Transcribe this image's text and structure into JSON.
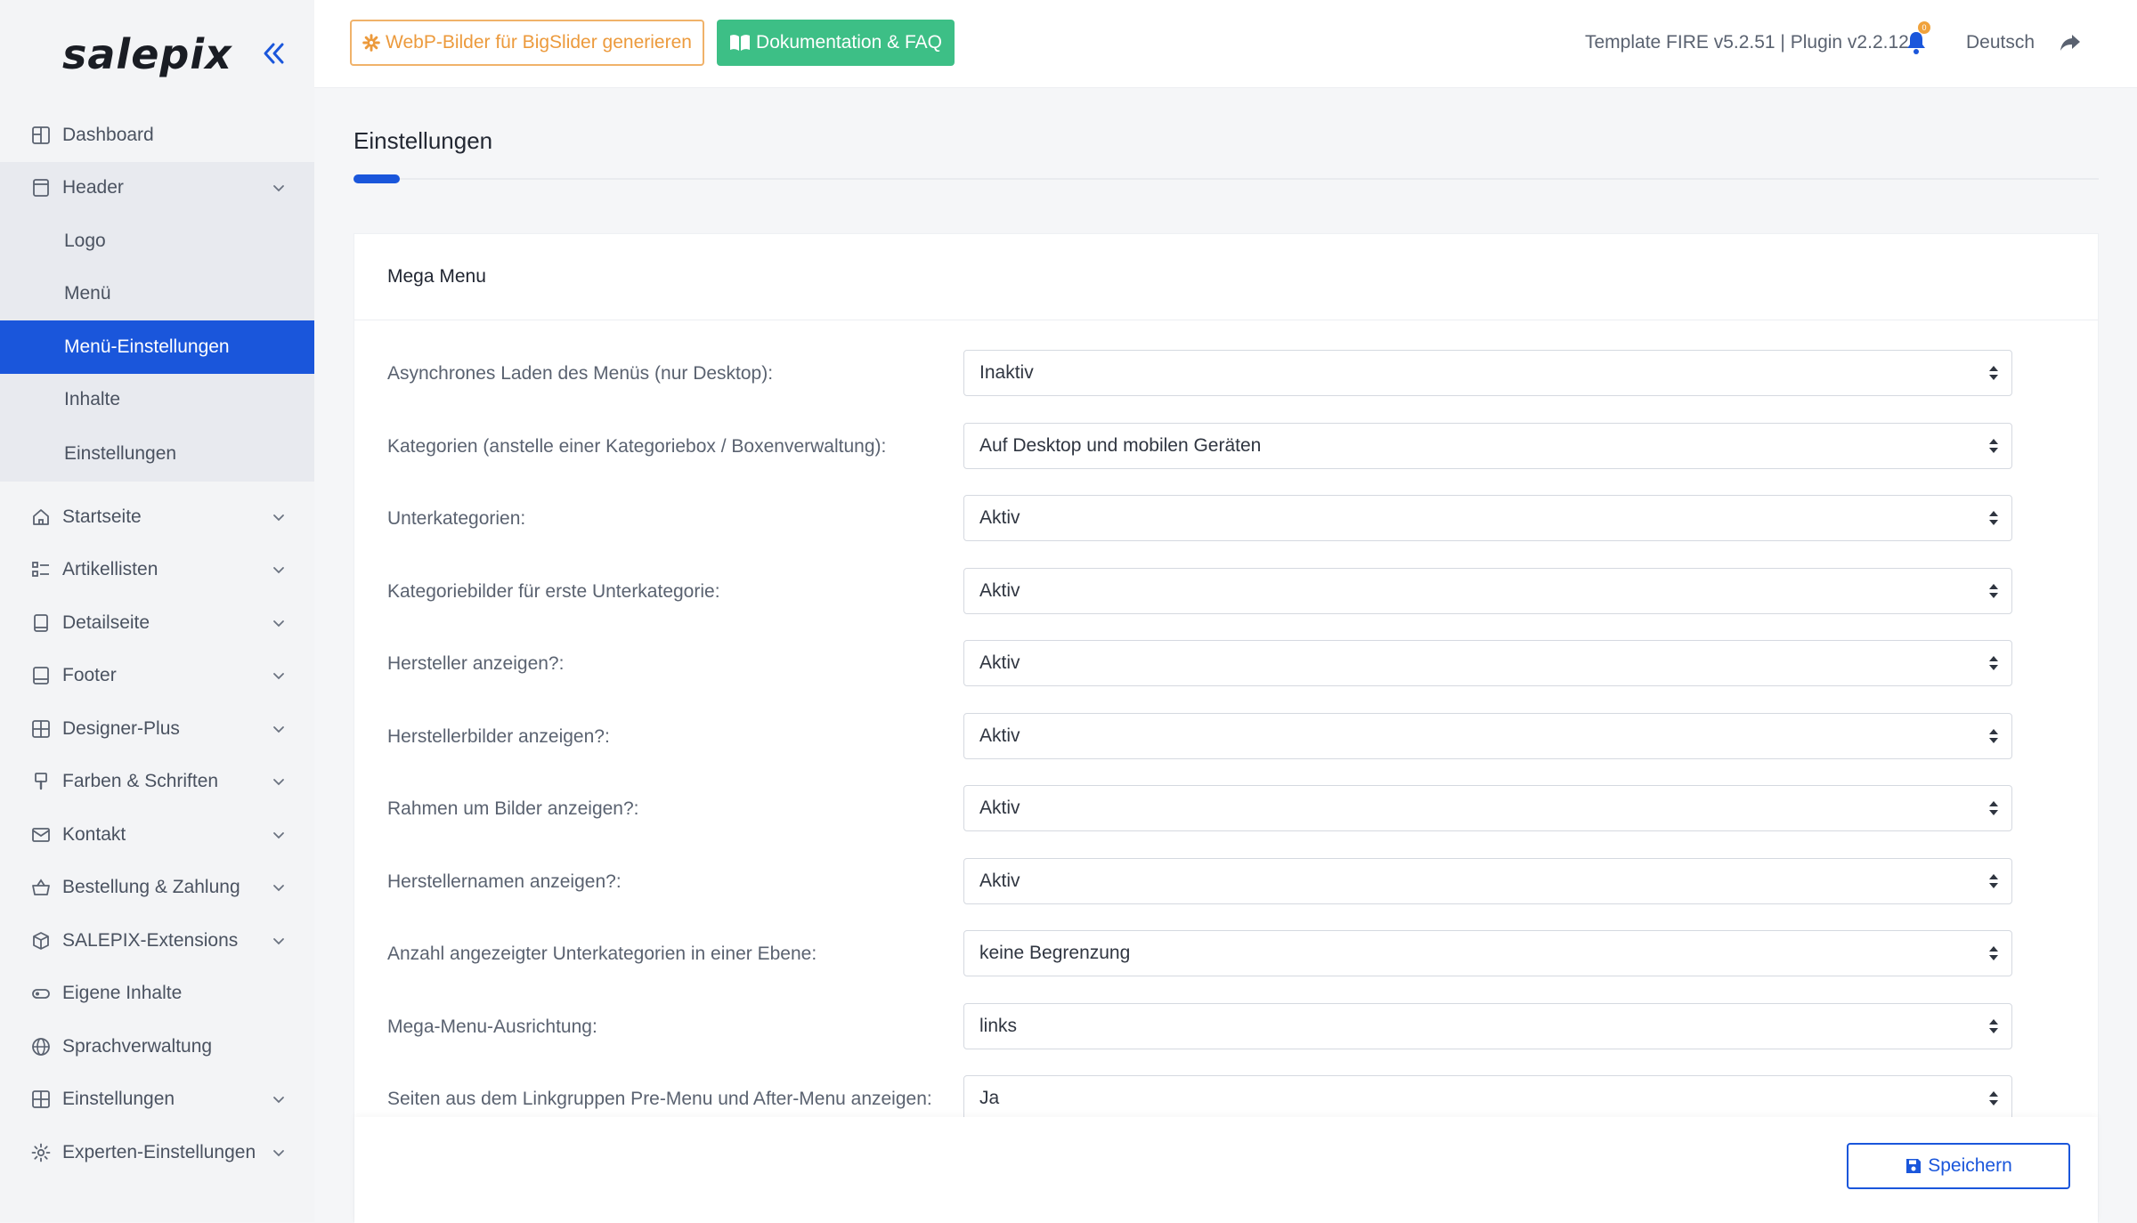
{
  "sidebar": {
    "logo": "salepix",
    "items_top": [
      {
        "label": "Dashboard"
      },
      {
        "label": "Header"
      }
    ],
    "header_sub": [
      {
        "label": "Logo"
      },
      {
        "label": "Menü"
      },
      {
        "label": "Menü-Einstellungen"
      },
      {
        "label": "Inhalte"
      },
      {
        "label": "Einstellungen"
      }
    ],
    "items": [
      {
        "label": "Startseite"
      },
      {
        "label": "Artikellisten"
      },
      {
        "label": "Detailseite"
      },
      {
        "label": "Footer"
      },
      {
        "label": "Designer-Plus"
      },
      {
        "label": "Farben & Schriften"
      },
      {
        "label": "Kontakt"
      },
      {
        "label": "Bestellung & Zahlung"
      },
      {
        "label": "SALEPIX-Extensions"
      },
      {
        "label": "Eigene Inhalte"
      },
      {
        "label": "Sprachverwaltung"
      },
      {
        "label": "Einstellungen"
      },
      {
        "label": "Experten-Einstellungen"
      }
    ]
  },
  "topbar": {
    "webp_label": "WebP-Bilder für BigSlider generieren",
    "doc_label": "Dokumentation & FAQ",
    "version": "Template FIRE v5.2.51 | Plugin v2.2.12",
    "badge": "0",
    "language": "Deutsch"
  },
  "page": {
    "title": "Einstellungen",
    "card_title": "Mega Menu",
    "save_label": "Speichern"
  },
  "form": [
    {
      "label": "Asynchrones Laden des Menüs (nur Desktop):",
      "value": "Inaktiv"
    },
    {
      "label": "Kategorien (anstelle einer Kategoriebox / Boxenverwaltung):",
      "value": "Auf Desktop und mobilen Geräten"
    },
    {
      "label": "Unterkategorien:",
      "value": "Aktiv"
    },
    {
      "label": "Kategoriebilder für erste Unterkategorie:",
      "value": "Aktiv"
    },
    {
      "label": "Hersteller anzeigen?:",
      "value": "Aktiv"
    },
    {
      "label": "Herstellerbilder anzeigen?:",
      "value": "Aktiv"
    },
    {
      "label": "Rahmen um Bilder anzeigen?:",
      "value": "Aktiv"
    },
    {
      "label": "Herstellernamen anzeigen?:",
      "value": "Aktiv"
    },
    {
      "label": "Anzahl angezeigter Unterkategorien in einer Ebene:",
      "value": "keine Begrenzung"
    },
    {
      "label": "Mega-Menu-Ausrichtung:",
      "value": "links"
    },
    {
      "label": "Seiten aus dem Linkgruppen Pre-Menu und After-Menu anzeigen:",
      "value": "Ja"
    }
  ],
  "colors": {
    "accent": "#1a56db",
    "orange": "#ec9a3c",
    "green": "#3dbf86"
  }
}
